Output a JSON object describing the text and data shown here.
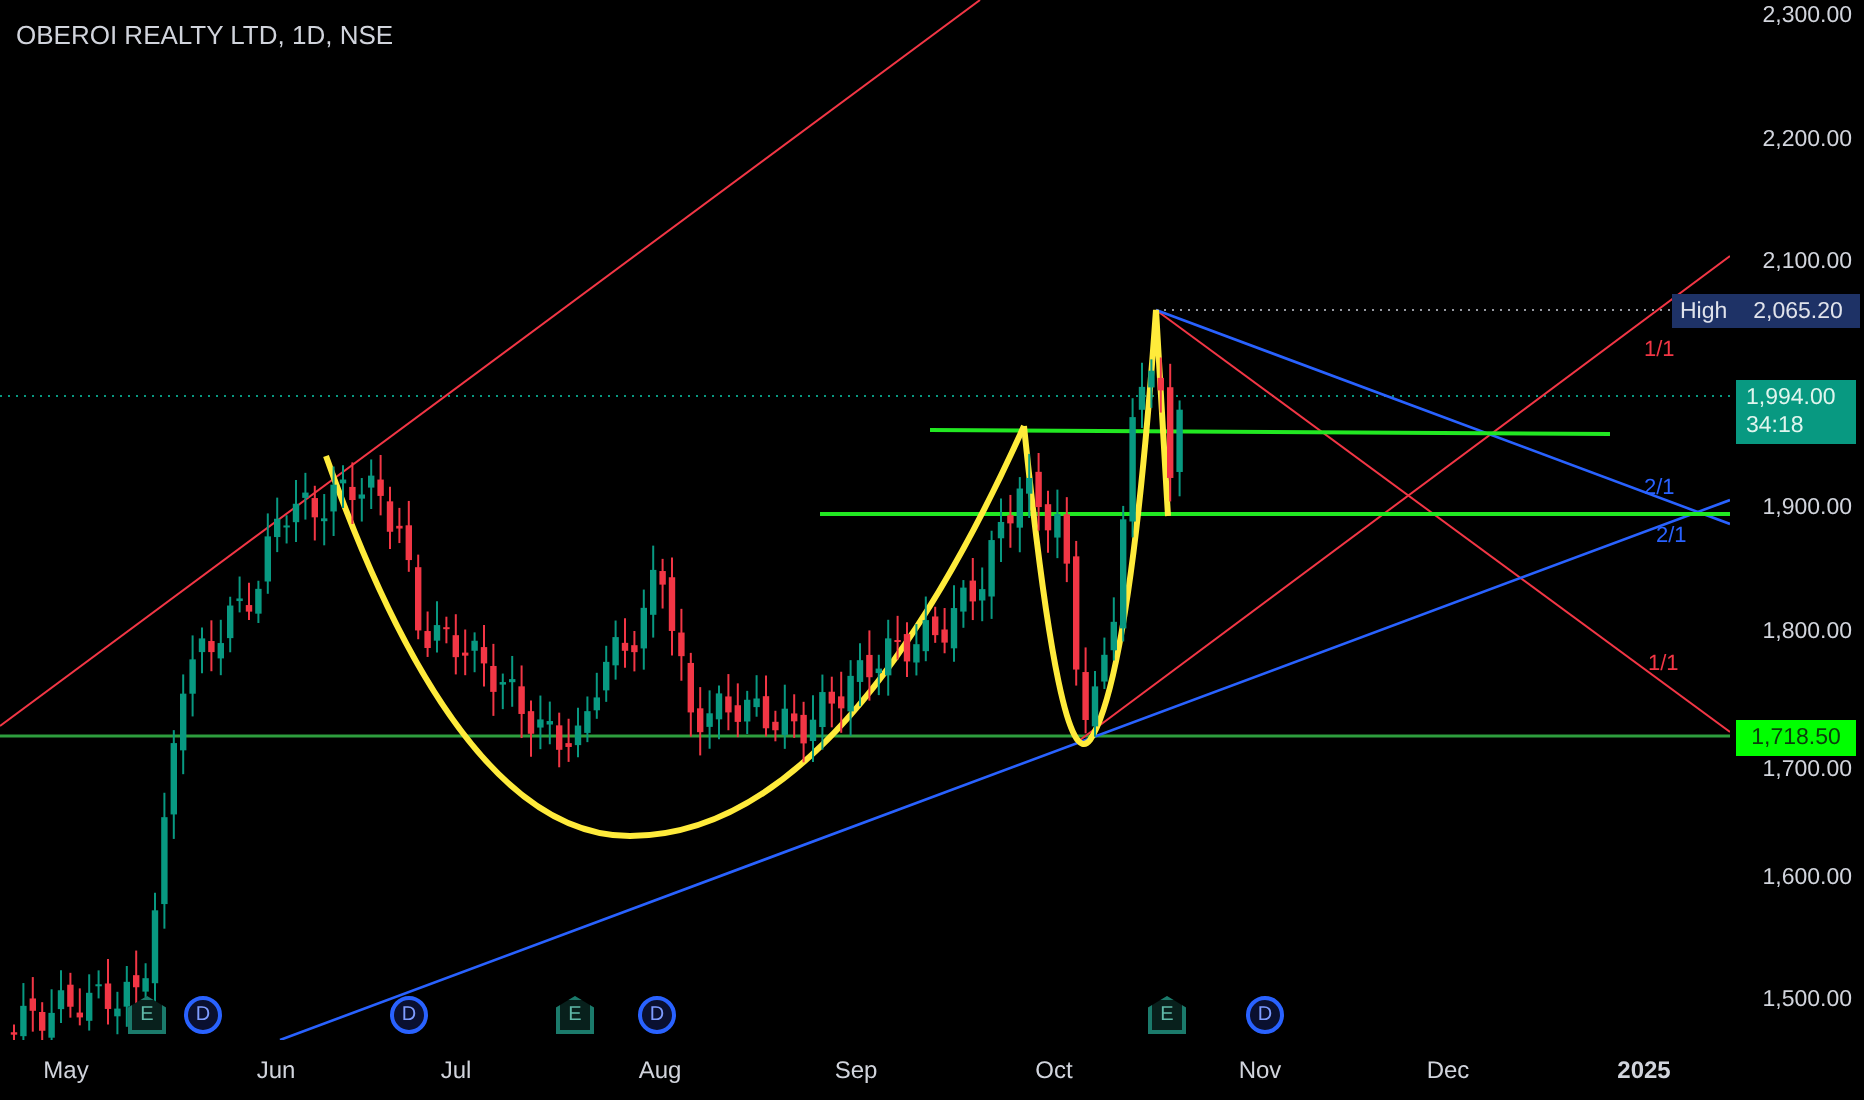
{
  "title": "OBEROI REALTY LTD, 1D, NSE",
  "price_axis": [
    "2,300.00",
    "2,200.00",
    "2,100.00",
    "1,900.00",
    "1,800.00",
    "1,700.00",
    "1,600.00",
    "1,500.00"
  ],
  "time_axis": [
    {
      "label": "May",
      "kind": "month"
    },
    {
      "label": "Jun",
      "kind": "month"
    },
    {
      "label": "Jul",
      "kind": "month"
    },
    {
      "label": "Aug",
      "kind": "month"
    },
    {
      "label": "Sep",
      "kind": "month"
    },
    {
      "label": "Oct",
      "kind": "month"
    },
    {
      "label": "Nov",
      "kind": "month"
    },
    {
      "label": "Dec",
      "kind": "month"
    },
    {
      "label": "2025",
      "kind": "year"
    }
  ],
  "high_badge": {
    "label": "High",
    "value": "2,065.20"
  },
  "last_price_badge": {
    "price": "1,994.00",
    "countdown": "34:18"
  },
  "level_badge": {
    "value": "1,718.50"
  },
  "line_labels": [
    {
      "text": "1/1",
      "kind": "red"
    },
    {
      "text": "2/1",
      "kind": "blue"
    },
    {
      "text": "2/1",
      "kind": "blue"
    },
    {
      "text": "1/1",
      "kind": "red"
    }
  ],
  "event_markers": [
    {
      "kind": "earnings",
      "label": "E"
    },
    {
      "kind": "dividend",
      "label": "D"
    },
    {
      "kind": "dividend",
      "label": "D"
    },
    {
      "kind": "earnings",
      "label": "E"
    },
    {
      "kind": "dividend",
      "label": "D"
    },
    {
      "kind": "earnings",
      "label": "E"
    },
    {
      "kind": "dividend",
      "label": "D"
    }
  ]
}
